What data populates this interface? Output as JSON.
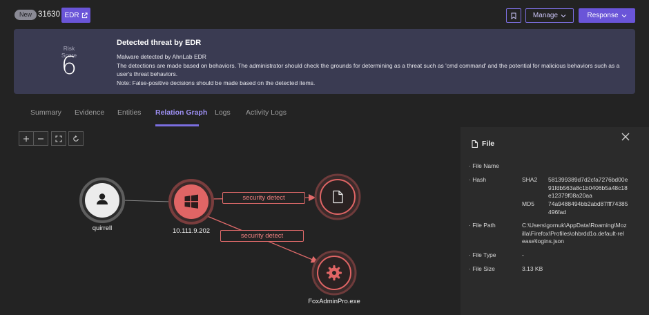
{
  "header": {
    "badge": "New",
    "ticket_id": "31630",
    "edr_button": "EDR",
    "manage_button": "Manage",
    "response_button": "Response"
  },
  "threat": {
    "risk_label": "Risk Score",
    "risk_score": "6",
    "title": "Detected threat by EDR",
    "line1": "Malware detected by AhnLab EDR",
    "line2": "The detections are made based on behaviors. The administrator should check the grounds for determining as a threat such as 'cmd command' and the potential for malicious behaviors such as a user's threat behaviors.",
    "line3": "Note: False-positive decisions should be made based on the detected items."
  },
  "tabs": [
    "Summary",
    "Evidence",
    "Entities",
    "Relation Graph",
    "Logs",
    "Activity Logs"
  ],
  "active_tab": "Relation Graph",
  "graph": {
    "nodes": {
      "user": "quirrell",
      "host": "10.111.9.202",
      "process": "FoxAdminPro.exe"
    },
    "edges": {
      "to_file": "security detect",
      "to_process": "security detect"
    }
  },
  "panel": {
    "title": "File",
    "file_name_label": "File Name",
    "hash_label": "Hash",
    "sha2_label": "SHA2",
    "sha2_value": "581399389d7d2cfa7276bd00e91fdb563a8c1b0406b5a48c18e12379f08a20aa",
    "md5_label": "MD5",
    "md5_value": "74a9488494bb2abd87fff74385496fad",
    "file_path_label": "File Path",
    "file_path_value": "C:\\Users\\gornuk\\AppData\\Roaming\\Mozilla\\Firefox\\Profiles\\ohbrdd1o.default-release\\logins.json",
    "file_type_label": "File Type",
    "file_type_value": "-",
    "file_size_label": "File Size",
    "file_size_value": "3.13 KB"
  },
  "colors": {
    "accent": "#6a55d8",
    "card_bg": "#3a3b52",
    "detect_red": "#e06a6a"
  }
}
